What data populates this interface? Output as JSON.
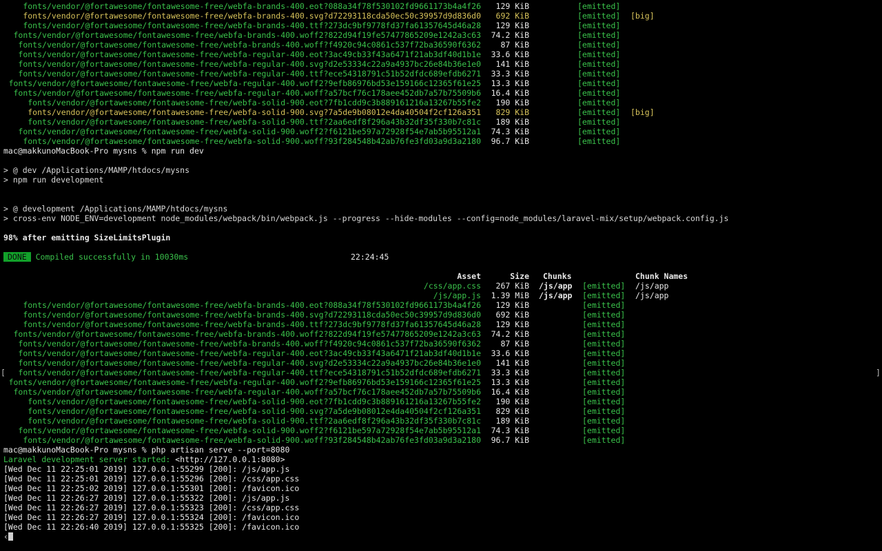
{
  "top_rows": [
    {
      "asset": "fonts/vendor/@fortawesome/fontawesome-free/webfa-brands-400.eot?088a34f78f530102fd9661173b4a4f26",
      "size": "129 KiB",
      "status": "[emitted]",
      "flag": "",
      "big": false
    },
    {
      "asset": "fonts/vendor/@fortawesome/fontawesome-free/webfa-brands-400.svg?d72293118cda50ec50c39957d9d836d0",
      "size": "692 KiB",
      "status": "[emitted]",
      "flag": "[big]",
      "big": true
    },
    {
      "asset": "fonts/vendor/@fortawesome/fontawesome-free/webfa-brands-400.ttf?273dc9bf9778fd37fa61357645d46a28",
      "size": "129 KiB",
      "status": "[emitted]",
      "flag": "",
      "big": false
    },
    {
      "asset": "fonts/vendor/@fortawesome/fontawesome-free/webfa-brands-400.woff2?822d94f19fe57477865209e1242a3c63",
      "size": "74.2 KiB",
      "status": "[emitted]",
      "flag": "",
      "big": false
    },
    {
      "asset": "fonts/vendor/@fortawesome/fontawesome-free/webfa-brands-400.woff?f4920c94c0861c537f72ba36590f6362",
      "size": "87 KiB",
      "status": "[emitted]",
      "flag": "",
      "big": false
    },
    {
      "asset": "fonts/vendor/@fortawesome/fontawesome-free/webfa-regular-400.eot?3ac49cb33f43a6471f21ab3df40d1b1e",
      "size": "33.6 KiB",
      "status": "[emitted]",
      "flag": "",
      "big": false
    },
    {
      "asset": "fonts/vendor/@fortawesome/fontawesome-free/webfa-regular-400.svg?d2e53334c22a9a4937bc26e84b36e1e0",
      "size": "141 KiB",
      "status": "[emitted]",
      "flag": "",
      "big": false
    },
    {
      "asset": "fonts/vendor/@fortawesome/fontawesome-free/webfa-regular-400.ttf?ece54318791c51b52dfdc689efdb6271",
      "size": "33.3 KiB",
      "status": "[emitted]",
      "flag": "",
      "big": false
    },
    {
      "asset": "fonts/vendor/@fortawesome/fontawesome-free/webfa-regular-400.woff2?9efb86976bd53e159166c12365f61e25",
      "size": "13.3 KiB",
      "status": "[emitted]",
      "flag": "",
      "big": false
    },
    {
      "asset": "fonts/vendor/@fortawesome/fontawesome-free/webfa-regular-400.woff?a57bcf76c178aee452db7a57b75509b6",
      "size": "16.4 KiB",
      "status": "[emitted]",
      "flag": "",
      "big": false
    },
    {
      "asset": "fonts/vendor/@fortawesome/fontawesome-free/webfa-solid-900.eot?7fb1cdd9c3b889161216a13267b55fe2",
      "size": "190 KiB",
      "status": "[emitted]",
      "flag": "",
      "big": false
    },
    {
      "asset": "fonts/vendor/@fortawesome/fontawesome-free/webfa-solid-900.svg?7a5de9b08012e4da40504f2cf126a351",
      "size": "829 KiB",
      "status": "[emitted]",
      "flag": "[big]",
      "big": true
    },
    {
      "asset": "fonts/vendor/@fortawesome/fontawesome-free/webfa-solid-900.ttf?2aa6edf8f296a43b32df35f330b7c81c",
      "size": "189 KiB",
      "status": "[emitted]",
      "flag": "",
      "big": false
    },
    {
      "asset": "fonts/vendor/@fortawesome/fontawesome-free/webfa-solid-900.woff2?f6121be597a72928f54e7ab5b95512a1",
      "size": "74.3 KiB",
      "status": "[emitted]",
      "flag": "",
      "big": false
    },
    {
      "asset": "fonts/vendor/@fortawesome/fontawesome-free/webfa-solid-900.woff?93f284548b42ab76fe3fd03a9d3a2180",
      "size": "96.7 KiB",
      "status": "[emitted]",
      "flag": "",
      "big": false
    }
  ],
  "prompt1": "mac@makkunoMacBook-Pro mysns % npm run dev",
  "npm_lines": [
    "> @ dev /Applications/MAMP/htdocs/mysns",
    "> npm run development",
    "> @ development /Applications/MAMP/htdocs/mysns",
    "> cross-env NODE_ENV=development node_modules/webpack/bin/webpack.js --progress --hide-modules --config=node_modules/laravel-mix/setup/webpack.config.js"
  ],
  "progress": "98% after emitting SizeLimitsPlugin",
  "done_badge": "DONE",
  "compiled": "Compiled successfully in 10030ms",
  "time": "22:24:45",
  "table_header": {
    "asset": "Asset",
    "size": "Size",
    "chunks": "Chunks",
    "chunk_names": "Chunk Names"
  },
  "main_rows": [
    {
      "asset": "/css/app.css",
      "size": "267 KiB",
      "chunks": "/js/app",
      "status": "[emitted]",
      "names": "/js/app"
    },
    {
      "asset": "/js/app.js",
      "size": "1.39 MiB",
      "chunks": "/js/app",
      "status": "[emitted]",
      "names": "/js/app"
    }
  ],
  "bottom_rows": [
    {
      "asset": "fonts/vendor/@fortawesome/fontawesome-free/webfa-brands-400.eot?088a34f78f530102fd9661173b4a4f26",
      "size": "129 KiB",
      "status": "[emitted]"
    },
    {
      "asset": "fonts/vendor/@fortawesome/fontawesome-free/webfa-brands-400.svg?d72293118cda50ec50c39957d9d836d0",
      "size": "692 KiB",
      "status": "[emitted]"
    },
    {
      "asset": "fonts/vendor/@fortawesome/fontawesome-free/webfa-brands-400.ttf?273dc9bf9778fd37fa61357645d46a28",
      "size": "129 KiB",
      "status": "[emitted]"
    },
    {
      "asset": "fonts/vendor/@fortawesome/fontawesome-free/webfa-brands-400.woff2?822d94f19fe57477865209e1242a3c63",
      "size": "74.2 KiB",
      "status": "[emitted]"
    },
    {
      "asset": "fonts/vendor/@fortawesome/fontawesome-free/webfa-brands-400.woff?f4920c94c0861c537f72ba36590f6362",
      "size": "87 KiB",
      "status": "[emitted]"
    },
    {
      "asset": "fonts/vendor/@fortawesome/fontawesome-free/webfa-regular-400.eot?3ac49cb33f43a6471f21ab3df40d1b1e",
      "size": "33.6 KiB",
      "status": "[emitted]"
    },
    {
      "asset": "fonts/vendor/@fortawesome/fontawesome-free/webfa-regular-400.svg?d2e53334c22a9a4937bc26e84b36e1e0",
      "size": "141 KiB",
      "status": "[emitted]"
    },
    {
      "asset": "fonts/vendor/@fortawesome/fontawesome-free/webfa-regular-400.ttf?ece54318791c51b52dfdc689efdb6271",
      "size": "33.3 KiB",
      "status": "[emitted]"
    },
    {
      "asset": "fonts/vendor/@fortawesome/fontawesome-free/webfa-regular-400.woff2?9efb86976bd53e159166c12365f61e25",
      "size": "13.3 KiB",
      "status": "[emitted]"
    },
    {
      "asset": "fonts/vendor/@fortawesome/fontawesome-free/webfa-regular-400.woff?a57bcf76c178aee452db7a57b75509b6",
      "size": "16.4 KiB",
      "status": "[emitted]"
    },
    {
      "asset": "fonts/vendor/@fortawesome/fontawesome-free/webfa-solid-900.eot?7fb1cdd9c3b889161216a13267b55fe2",
      "size": "190 KiB",
      "status": "[emitted]"
    },
    {
      "asset": "fonts/vendor/@fortawesome/fontawesome-free/webfa-solid-900.svg?7a5de9b08012e4da40504f2cf126a351",
      "size": "829 KiB",
      "status": "[emitted]"
    },
    {
      "asset": "fonts/vendor/@fortawesome/fontawesome-free/webfa-solid-900.ttf?2aa6edf8f296a43b32df35f330b7c81c",
      "size": "189 KiB",
      "status": "[emitted]"
    },
    {
      "asset": "fonts/vendor/@fortawesome/fontawesome-free/webfa-solid-900.woff2?f6121be597a72928f54e7ab5b95512a1",
      "size": "74.3 KiB",
      "status": "[emitted]"
    },
    {
      "asset": "fonts/vendor/@fortawesome/fontawesome-free/webfa-solid-900.woff?93f284548b42ab76fe3fd03a9d3a2180",
      "size": "96.7 KiB",
      "status": "[emitted]"
    }
  ],
  "prompt2": "mac@makkunoMacBook-Pro mysns % php artisan serve --port=8080",
  "laravel_started": "Laravel development server started:",
  "laravel_url": "<http://127.0.0.1:8080>",
  "server_log": [
    "[Wed Dec 11 22:25:01 2019] 127.0.0.1:55299 [200]: /js/app.js",
    "[Wed Dec 11 22:25:01 2019] 127.0.0.1:55296 [200]: /css/app.css",
    "[Wed Dec 11 22:25:02 2019] 127.0.0.1:55301 [200]: /favicon.ico",
    "[Wed Dec 11 22:26:27 2019] 127.0.0.1:55322 [200]: /js/app.js",
    "[Wed Dec 11 22:26:27 2019] 127.0.0.1:55323 [200]: /css/app.css",
    "[Wed Dec 11 22:26:27 2019] 127.0.0.1:55324 [200]: /favicon.ico",
    "[Wed Dec 11 22:26:40 2019] 127.0.0.1:55325 [200]: /favicon.ico"
  ],
  "edge_left": "[",
  "edge_right": "]",
  "cursor_prefix": "‹",
  "colors": {
    "green": "#3ac24b",
    "yellow": "#d6c25a",
    "badge": "#12a12a",
    "background": "#000000"
  }
}
